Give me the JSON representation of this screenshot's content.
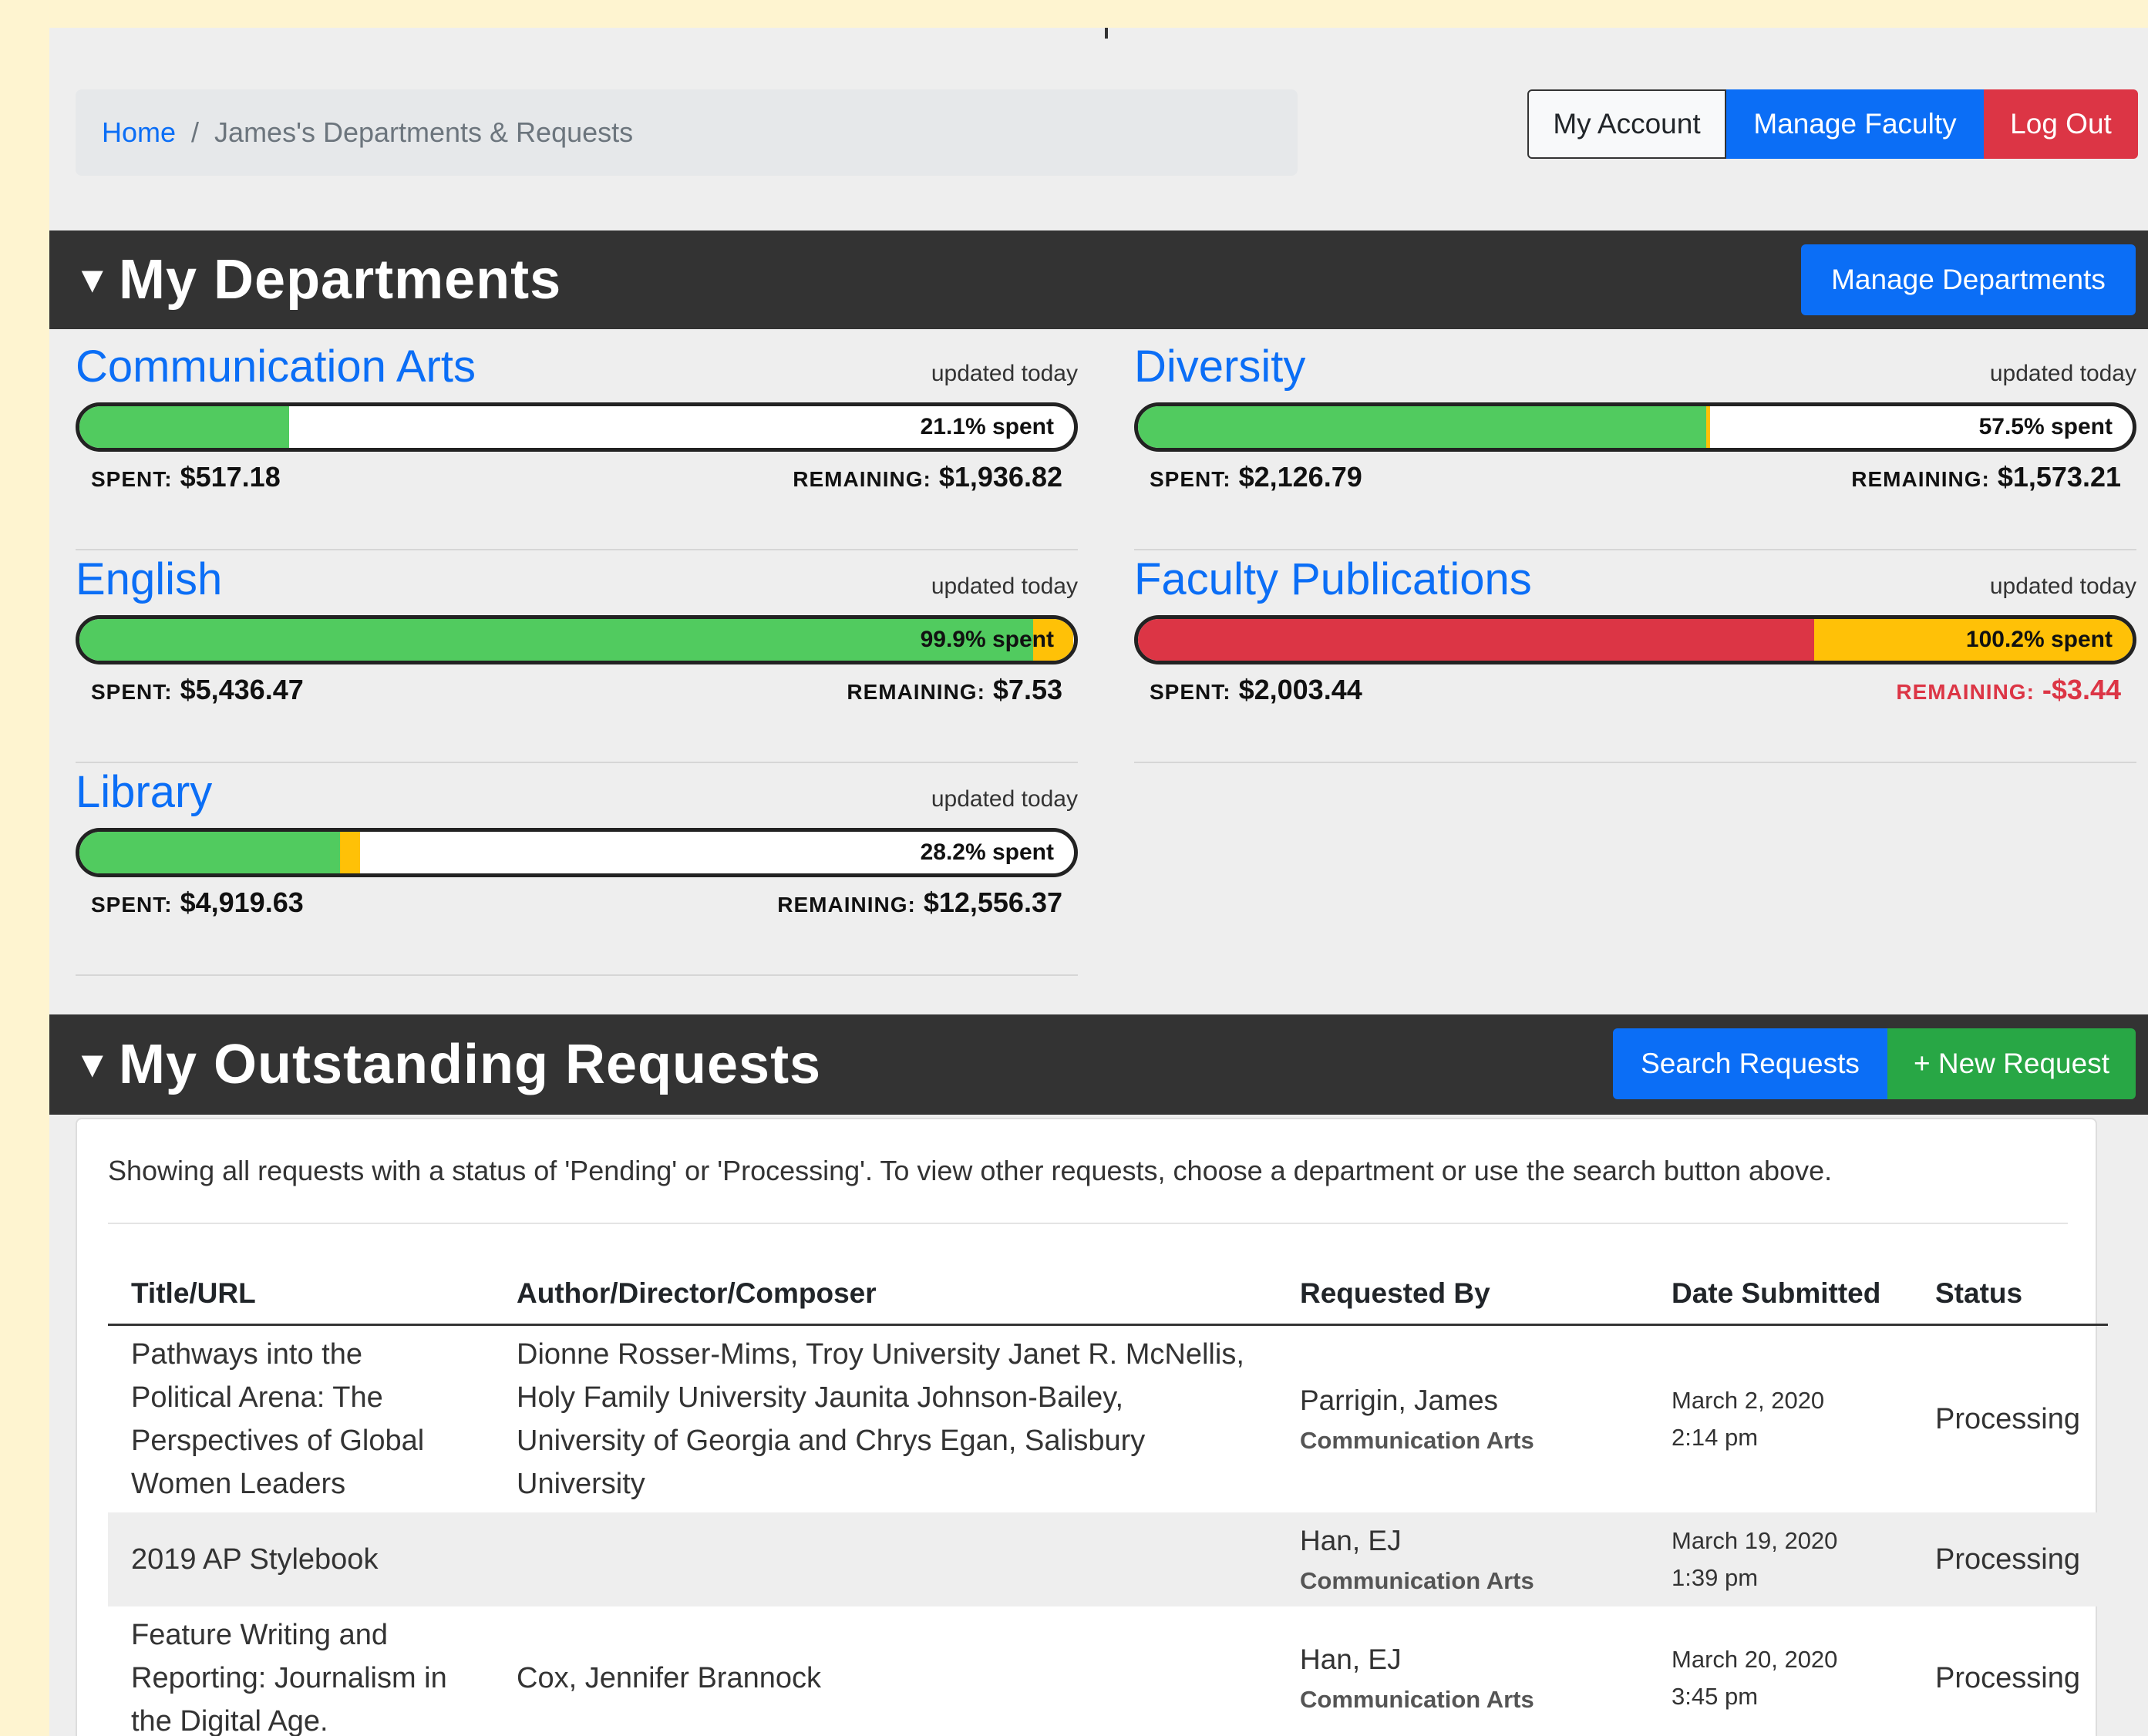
{
  "breadcrumb": {
    "home": "Home",
    "separator": "/",
    "current": "James's Departments & Requests"
  },
  "top_buttons": {
    "account": "My Account",
    "faculty": "Manage Faculty",
    "logout": "Log Out"
  },
  "departments_section": {
    "caret": "▼",
    "title": "My Departments",
    "manage_button": "Manage Departments"
  },
  "departments": [
    {
      "name": "Communication Arts",
      "updated": "updated today",
      "percent_label": "21.1% spent",
      "spent_label": "SPENT:",
      "spent": "$517.18",
      "remaining_label": "REMAINING:",
      "remaining": "$1,936.82",
      "spent_fraction": 0.211,
      "pending_fraction": 0.0
    },
    {
      "name": "Diversity",
      "updated": "updated today",
      "percent_label": "57.5% spent",
      "spent_label": "SPENT:",
      "spent": "$2,126.79",
      "remaining_label": "REMAINING:",
      "remaining": "$1,573.21",
      "spent_fraction": 0.571,
      "pending_fraction": 0.004
    },
    {
      "name": "English",
      "updated": "updated today",
      "percent_label": "99.9% spent",
      "spent_label": "SPENT:",
      "spent": "$5,436.47",
      "remaining_label": "REMAINING:",
      "remaining": "$7.53",
      "spent_fraction": 0.959,
      "pending_fraction": 0.04
    },
    {
      "name": "Faculty Publications",
      "updated": "updated today",
      "percent_label": "100.2% spent",
      "spent_label": "SPENT:",
      "spent": "$2,003.44",
      "remaining_label": "REMAINING:",
      "remaining": "-$3.44",
      "spent_fraction": 0.68,
      "pending_fraction": 0.32,
      "over_budget": true
    },
    {
      "name": "Library",
      "updated": "updated today",
      "percent_label": "28.2% spent",
      "spent_label": "SPENT:",
      "spent": "$4,919.63",
      "remaining_label": "REMAINING:",
      "remaining": "$12,556.37",
      "spent_fraction": 0.262,
      "pending_fraction": 0.02
    }
  ],
  "colors": {
    "spent": "#51cb5f",
    "pending": "#ffc107",
    "over": "#dc3545",
    "primary": "#0b6ef6",
    "success": "#28a745",
    "danger": "#dc3545"
  },
  "requests_section": {
    "caret": "▼",
    "title": "My Outstanding Requests",
    "search_button": "Search Requests",
    "new_button": "+ New Request"
  },
  "requests": {
    "intro": "Showing all requests with a status of 'Pending' or 'Processing'. To view other requests, choose a department or use the search button above.",
    "columns": [
      "Title/URL",
      "Author/Director/Composer",
      "Requested By",
      "Date Submitted",
      "Status"
    ],
    "rows": [
      {
        "title": "Pathways into the Political Arena: The Perspectives of Global Women Leaders",
        "author": "Dionne Rosser-Mims, Troy University Janet R. McNellis, Holy Family University Jaunita Johnson-Bailey, University of Georgia and Chrys Egan, Salisbury University",
        "requester": "Parrigin, James",
        "department": "Communication Arts",
        "date": "March 2, 2020",
        "time": "2:14 pm",
        "status": "Processing"
      },
      {
        "title": "2019 AP Stylebook",
        "author": "",
        "requester": "Han, EJ",
        "department": "Communication Arts",
        "date": "March 19, 2020",
        "time": "1:39 pm",
        "status": "Processing"
      },
      {
        "title": "Feature Writing and Reporting: Journalism in the Digital Age.",
        "author": "Cox, Jennifer Brannock",
        "requester": "Han, EJ",
        "department": "Communication Arts",
        "date": "March 20, 2020",
        "time": "3:45 pm",
        "status": "Processing"
      }
    ]
  }
}
